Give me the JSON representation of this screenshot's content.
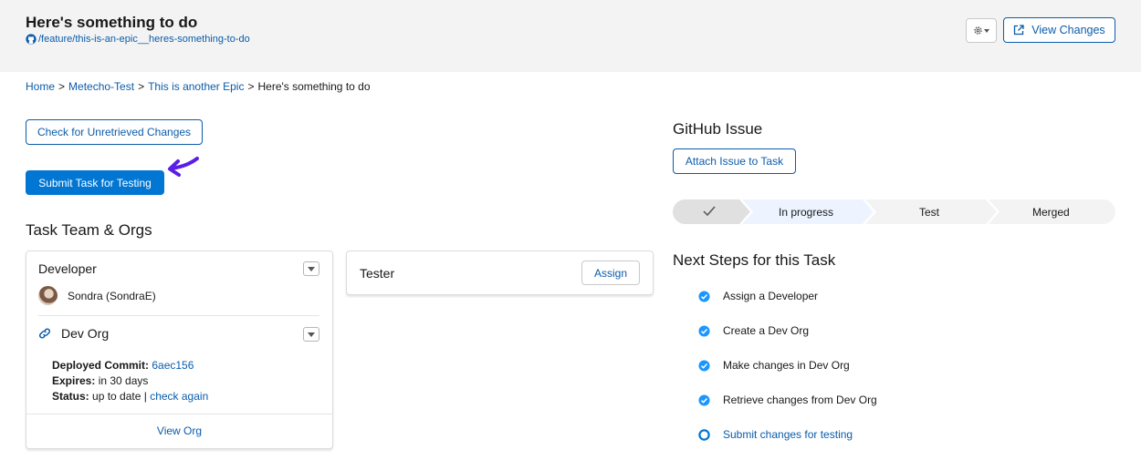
{
  "header": {
    "title": "Here's something to do",
    "branch": "/feature/this-is-an-epic__heres-something-to-do",
    "view_changes_label": "View Changes"
  },
  "breadcrumb": {
    "items": [
      "Home",
      "Metecho-Test",
      "This is another Epic"
    ],
    "current": "Here's something to do",
    "separator": ">"
  },
  "actions": {
    "check_label": "Check for Unretrieved Changes",
    "submit_label": "Submit Task for Testing"
  },
  "team": {
    "title": "Task Team & Orgs",
    "developer": {
      "role": "Developer",
      "user": "Sondra (SondraE)",
      "org_label": "Dev Org",
      "commit_label": "Deployed Commit:",
      "commit_value": "6aec156",
      "expires_label": "Expires:",
      "expires_value": "in 30 days",
      "status_label": "Status:",
      "status_value": "up to date |",
      "status_link": "check again",
      "view_org": "View Org"
    },
    "tester": {
      "role": "Tester",
      "assign_label": "Assign"
    }
  },
  "github": {
    "title": "GitHub Issue",
    "attach_label": "Attach Issue to Task"
  },
  "path": {
    "stages": [
      "In progress",
      "Test",
      "Merged"
    ],
    "completed_stage_icon": "check-icon",
    "colors": {
      "complete": "#e0e0e0",
      "current": "#eef4ff",
      "incomplete": "#f3f3f3"
    }
  },
  "next_steps": {
    "title": "Next Steps for this Task",
    "items": [
      {
        "label": "Assign a Developer",
        "done": true
      },
      {
        "label": "Create a Dev Org",
        "done": true
      },
      {
        "label": "Make changes in Dev Org",
        "done": true
      },
      {
        "label": "Retrieve changes from Dev Org",
        "done": true
      },
      {
        "label": "Submit changes for testing",
        "done": false
      }
    ]
  },
  "colors": {
    "brand": "#0176d3",
    "link": "#0b5cab",
    "check": "#1b96ff",
    "arrow": "#5a1ee6",
    "header_bg": "#f3f3f3"
  }
}
